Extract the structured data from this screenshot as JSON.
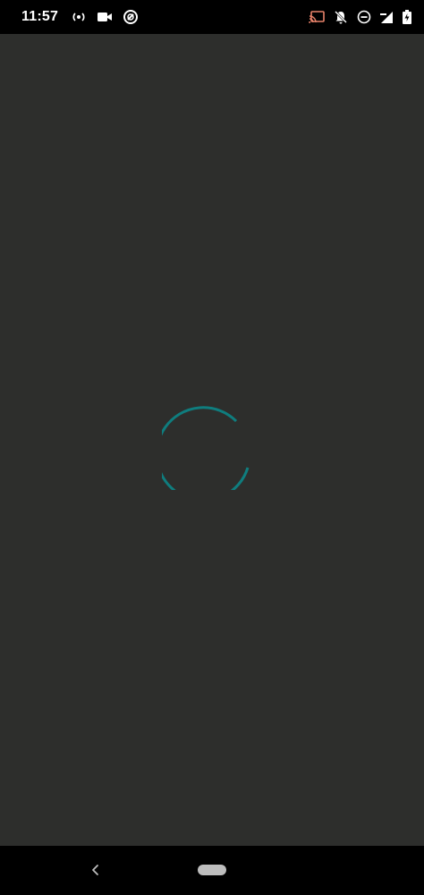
{
  "status_bar": {
    "time": "11:57",
    "left_icons": [
      "hotspot-icon",
      "video-camera-icon",
      "sync-disabled-icon"
    ],
    "right_icons": [
      "cast-icon",
      "notifications-off-icon",
      "do-not-disturb-icon",
      "signal-icon",
      "battery-icon"
    ]
  },
  "loading": {
    "spinner_color": "#0f7d7e"
  },
  "navigation": {
    "back_icon": "back-chevron-icon",
    "home_icon": "home-pill-icon"
  },
  "colors": {
    "background": "#2d2e2c",
    "bars": "#000000",
    "accent": "#0f7d7e"
  }
}
